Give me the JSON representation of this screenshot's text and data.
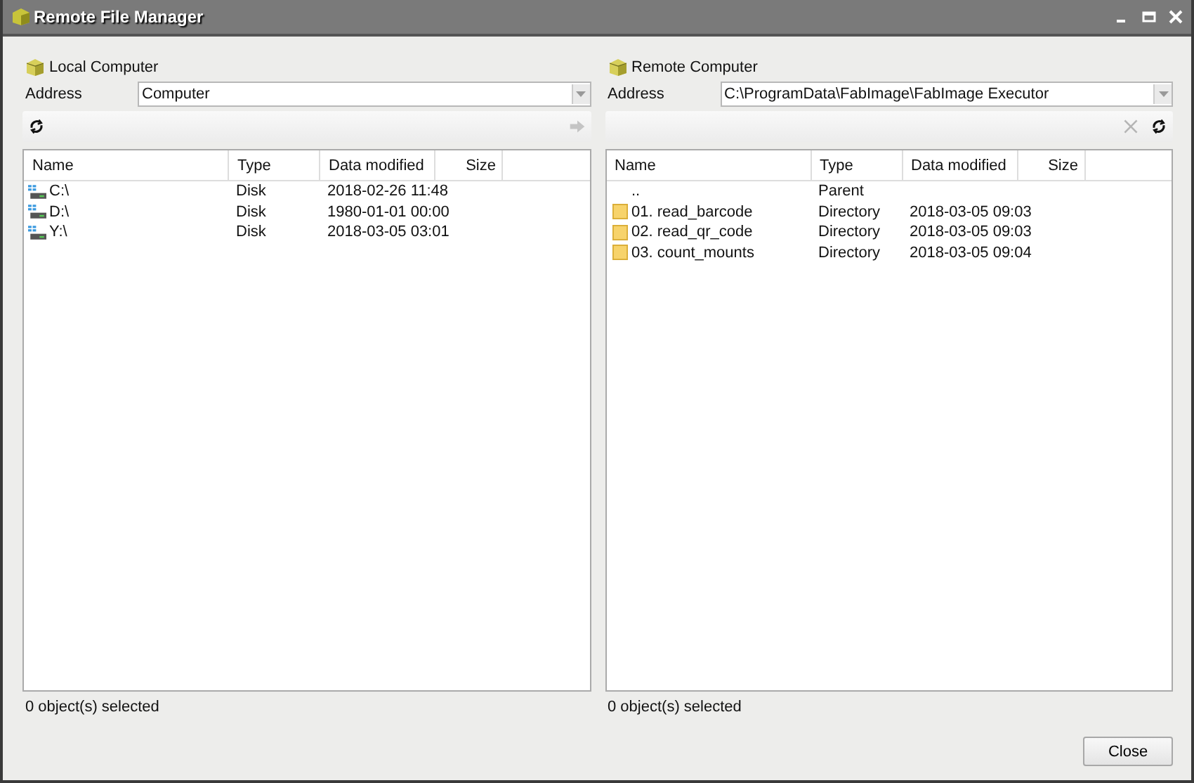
{
  "window": {
    "title": "Remote File Manager"
  },
  "panels": [
    {
      "title": "Local Computer",
      "address_label": "Address",
      "address": "Computer",
      "toolbar_left": [
        {
          "kind": "refresh",
          "disabled": false
        }
      ],
      "toolbar_right": [
        {
          "kind": "send",
          "disabled": true
        }
      ],
      "columns": [
        "Name",
        "Type",
        "Data modified",
        "Size"
      ],
      "rows": [
        {
          "kind": "drive",
          "name": "C:\\",
          "type": "Disk",
          "modified": "2018-02-26 11:48"
        },
        {
          "kind": "drive",
          "name": "D:\\",
          "type": "Disk",
          "modified": "1980-01-01 00:00"
        },
        {
          "kind": "drive",
          "name": "Y:\\",
          "type": "Disk",
          "modified": "2018-03-05 03:01"
        }
      ],
      "status": "0 object(s) selected"
    },
    {
      "title": "Remote Computer",
      "address_label": "Address",
      "address": "C:\\ProgramData\\FabImage\\FabImage Executor",
      "toolbar_right": [
        {
          "kind": "delete",
          "disabled": true
        },
        {
          "kind": "refresh",
          "disabled": false
        }
      ],
      "columns": [
        "Name",
        "Type",
        "Data modified",
        "Size"
      ],
      "rows": [
        {
          "kind": "parent",
          "name": "..",
          "type": "Parent"
        },
        {
          "kind": "folder",
          "name": "01. read_barcode",
          "type": "Directory",
          "modified": "2018-03-05 09:03"
        },
        {
          "kind": "folder",
          "name": "02. read_qr_code",
          "type": "Directory",
          "modified": "2018-03-05 09:03"
        },
        {
          "kind": "folder",
          "name": "03. count_mounts",
          "type": "Directory",
          "modified": "2018-03-05 09:04"
        }
      ],
      "status": "0 object(s) selected"
    }
  ],
  "buttons": [
    "Close"
  ]
}
